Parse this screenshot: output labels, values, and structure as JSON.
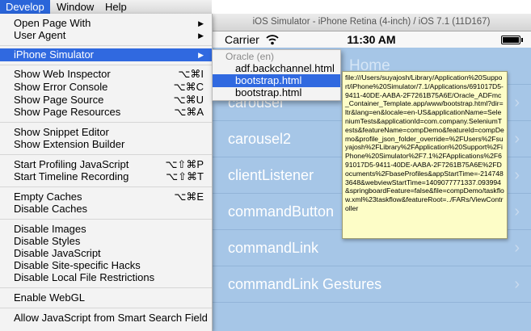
{
  "menubar": {
    "items": [
      "Develop",
      "Window",
      "Help"
    ]
  },
  "simulator": {
    "title": "iOS Simulator - iPhone Retina (4-inch) / iOS 7.1 (11D167)",
    "status": {
      "carrier": "Carrier",
      "time": "11:30 AM"
    },
    "header": "Home",
    "rows": [
      "carousel",
      "carousel2",
      "clientListener",
      "commandButton",
      "commandLink",
      "commandLink Gestures"
    ]
  },
  "develop_menu": {
    "items": [
      {
        "label": "Open Page With",
        "submenu": true
      },
      {
        "label": "User Agent",
        "submenu": true
      },
      {
        "label": "iPhone Simulator",
        "submenu": true,
        "highlighted": true
      },
      {
        "label": "Show Web Inspector",
        "shortcut": "⌥⌘I"
      },
      {
        "label": "Show Error Console",
        "shortcut": "⌥⌘C"
      },
      {
        "label": "Show Page Source",
        "shortcut": "⌥⌘U"
      },
      {
        "label": "Show Page Resources",
        "shortcut": "⌥⌘A"
      },
      {
        "label": "Show Snippet Editor"
      },
      {
        "label": "Show Extension Builder"
      },
      {
        "label": "Start Profiling JavaScript",
        "shortcut": "⌥⇧⌘P"
      },
      {
        "label": "Start Timeline Recording",
        "shortcut": "⌥⇧⌘T"
      },
      {
        "label": "Empty Caches",
        "shortcut": "⌥⌘E"
      },
      {
        "label": "Disable Caches"
      },
      {
        "label": "Disable Images"
      },
      {
        "label": "Disable Styles"
      },
      {
        "label": "Disable JavaScript"
      },
      {
        "label": "Disable Site-specific Hacks"
      },
      {
        "label": "Disable Local File Restrictions"
      },
      {
        "label": "Enable WebGL"
      },
      {
        "label": "Allow JavaScript from Smart Search Field"
      }
    ]
  },
  "submenu": {
    "group": "Oracle (en)",
    "items": [
      "adf.backchannel.html",
      "bootstrap.html",
      "bootstrap.html"
    ],
    "highlighted_index": 1
  },
  "tooltip": {
    "text": "file:///Users/suyajosh/Library/Application%20Support/iPhone%20Simulator/7.1/Applications/691017D5-9411-40DE-AABA-2F7261B75A6E/Oracle_ADFmc_Container_Template.app/www/bootstrap.html?dir=ltr&lang=en&locale=en-US&applicationName=SeleniumTests&applicationId=com.company.SeleniumTests&featureName=compDemo&featureId=compDemo&profile_json_folder_override=%2FUsers%2Fsuyajosh%2FLibrary%2FApplication%20Support%2FiPhone%20Simulator%2F7.1%2FApplications%2F691017D5-9411-40DE-AABA-2F7261B75A6E%2FDocuments%2FbaseProfiles&appStartTime=-2147483648&webviewStartTime=1409077771337.093994&springboardFeature=false&file=compDemo/taskflow.xml%23taskflow&featureRoot=../FARs/ViewController"
  }
}
